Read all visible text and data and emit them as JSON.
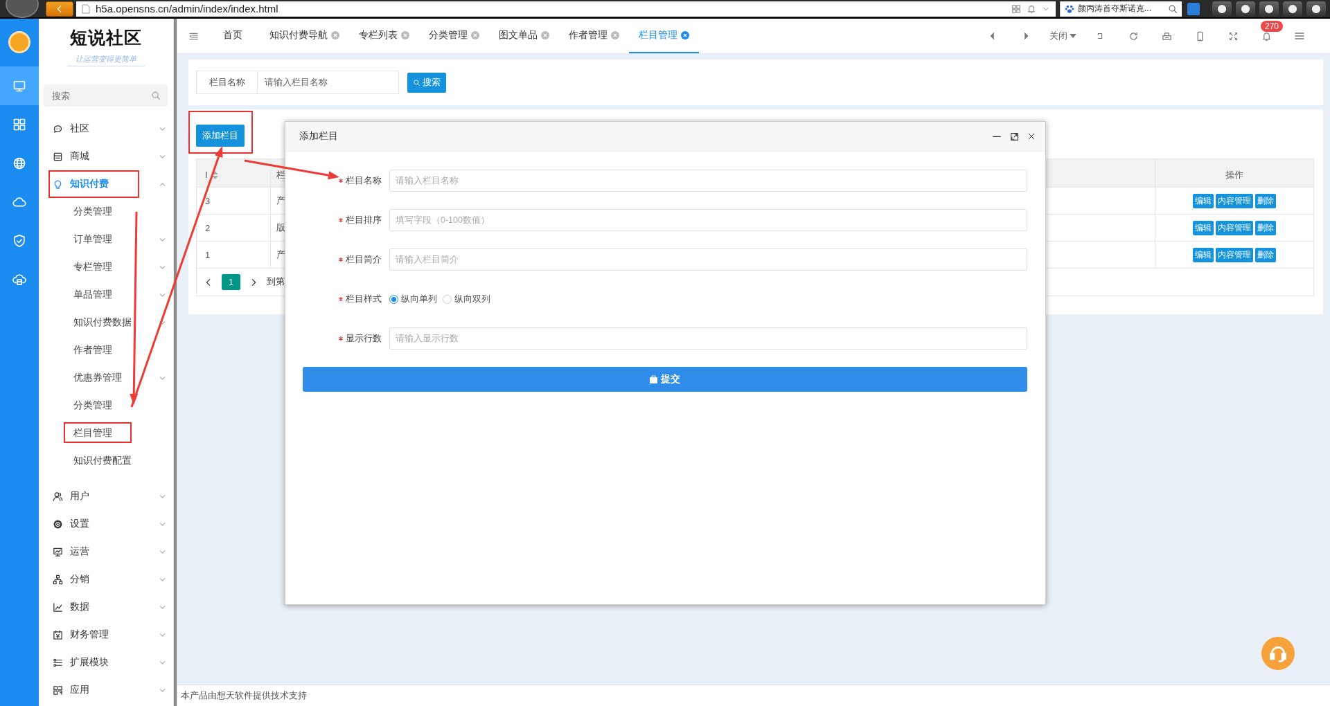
{
  "browser": {
    "url": "h5a.opensns.cn/admin/index/index.html",
    "search": "颜丙涛首夺斯诺克..."
  },
  "rail": [
    {
      "selected": true
    },
    {
      "selected": false
    },
    {
      "selected": false
    },
    {
      "selected": false
    },
    {
      "selected": false
    },
    {
      "selected": false
    }
  ],
  "sidebar": {
    "logo": "短说社区",
    "slogan": "让运营变得更简单",
    "search": {
      "placeholder": "搜索"
    },
    "items": [
      {
        "label": "社区",
        "expanded": false,
        "highlighted": false
      },
      {
        "label": "商城",
        "expanded": false,
        "highlighted": false
      },
      {
        "label": "知识付费",
        "expanded": true,
        "highlighted": true,
        "children": [
          {
            "label": "分类管理",
            "expandable": false,
            "highlighted": false
          },
          {
            "label": "订单管理",
            "expandable": true,
            "highlighted": false
          },
          {
            "label": "专栏管理",
            "expandable": true,
            "highlighted": false
          },
          {
            "label": "单品管理",
            "expandable": true,
            "highlighted": false
          },
          {
            "label": "知识付费数据",
            "expandable": true,
            "highlighted": false
          },
          {
            "label": "作者管理",
            "expandable": false,
            "highlighted": false
          },
          {
            "label": "优惠券管理",
            "expandable": true,
            "highlighted": false
          },
          {
            "label": "分类管理",
            "expandable": false,
            "highlighted": false
          },
          {
            "label": "栏目管理",
            "expandable": false,
            "highlighted": true
          },
          {
            "label": "知识付费配置",
            "expandable": false,
            "highlighted": false
          }
        ]
      },
      {
        "label": "用户",
        "expanded": false,
        "highlighted": false
      },
      {
        "label": "设置",
        "expanded": false,
        "highlighted": false
      },
      {
        "label": "运营",
        "expanded": false,
        "highlighted": false
      },
      {
        "label": "分销",
        "expanded": false,
        "highlighted": false
      },
      {
        "label": "数据",
        "expanded": false,
        "highlighted": false
      },
      {
        "label": "财务管理",
        "expanded": false,
        "highlighted": false
      },
      {
        "label": "扩展模块",
        "expanded": false,
        "highlighted": false
      },
      {
        "label": "应用",
        "expanded": false,
        "highlighted": false
      }
    ]
  },
  "tabs": [
    {
      "label": "首页",
      "closable": false,
      "selected": false
    },
    {
      "label": "知识付费导航",
      "closable": true,
      "selected": false
    },
    {
      "label": "专栏列表",
      "closable": true,
      "selected": false
    },
    {
      "label": "分类管理",
      "closable": true,
      "selected": false
    },
    {
      "label": "图文单品",
      "closable": true,
      "selected": false
    },
    {
      "label": "作者管理",
      "closable": true,
      "selected": false
    },
    {
      "label": "栏目管理",
      "closable": true,
      "selected": true
    }
  ],
  "toolbar": {
    "close_menu": "关闭",
    "notifications": "270"
  },
  "search_bar": {
    "label": "栏目名称",
    "placeholder": "请输入栏目名称",
    "button": "搜索"
  },
  "add_button": {
    "label": "添加栏目",
    "highlighted": true
  },
  "table": {
    "columns": [
      {
        "label": "I",
        "sortable": true
      },
      {
        "label": "栏",
        "sortable": false
      },
      {
        "label": "操作",
        "sortable": false
      }
    ],
    "rows": [
      {
        "id": "3",
        "name": "产",
        "actions": [
          "编辑",
          "内容管理",
          "删除"
        ]
      },
      {
        "id": "2",
        "name": "版",
        "actions": [
          "编辑",
          "内容管理",
          "删除"
        ]
      },
      {
        "id": "1",
        "name": "产",
        "actions": [
          "编辑",
          "内容管理",
          "删除"
        ]
      }
    ]
  },
  "pagination": {
    "pages": [
      {
        "label": "1",
        "selected": true
      }
    ],
    "goto": "到第"
  },
  "dialog": {
    "title": "添加栏目",
    "fields": [
      {
        "kind": "text",
        "label": "栏目名称",
        "required": true,
        "placeholder": "请输入栏目名称"
      },
      {
        "kind": "text",
        "label": "栏目排序",
        "required": true,
        "placeholder": "填写字段（0-100数值）"
      },
      {
        "kind": "text",
        "label": "栏目简介",
        "required": true,
        "placeholder": "请输入栏目简介"
      },
      {
        "kind": "radio",
        "label": "栏目样式",
        "required": true,
        "options": [
          {
            "label": "纵向单列",
            "selected": true
          },
          {
            "label": "纵向双列",
            "selected": false
          }
        ]
      },
      {
        "kind": "text",
        "label": "显示行数",
        "required": true,
        "placeholder": "请输入显示行数"
      }
    ],
    "submit": "提交"
  },
  "footer": "本产品由想天软件提供技术支持"
}
